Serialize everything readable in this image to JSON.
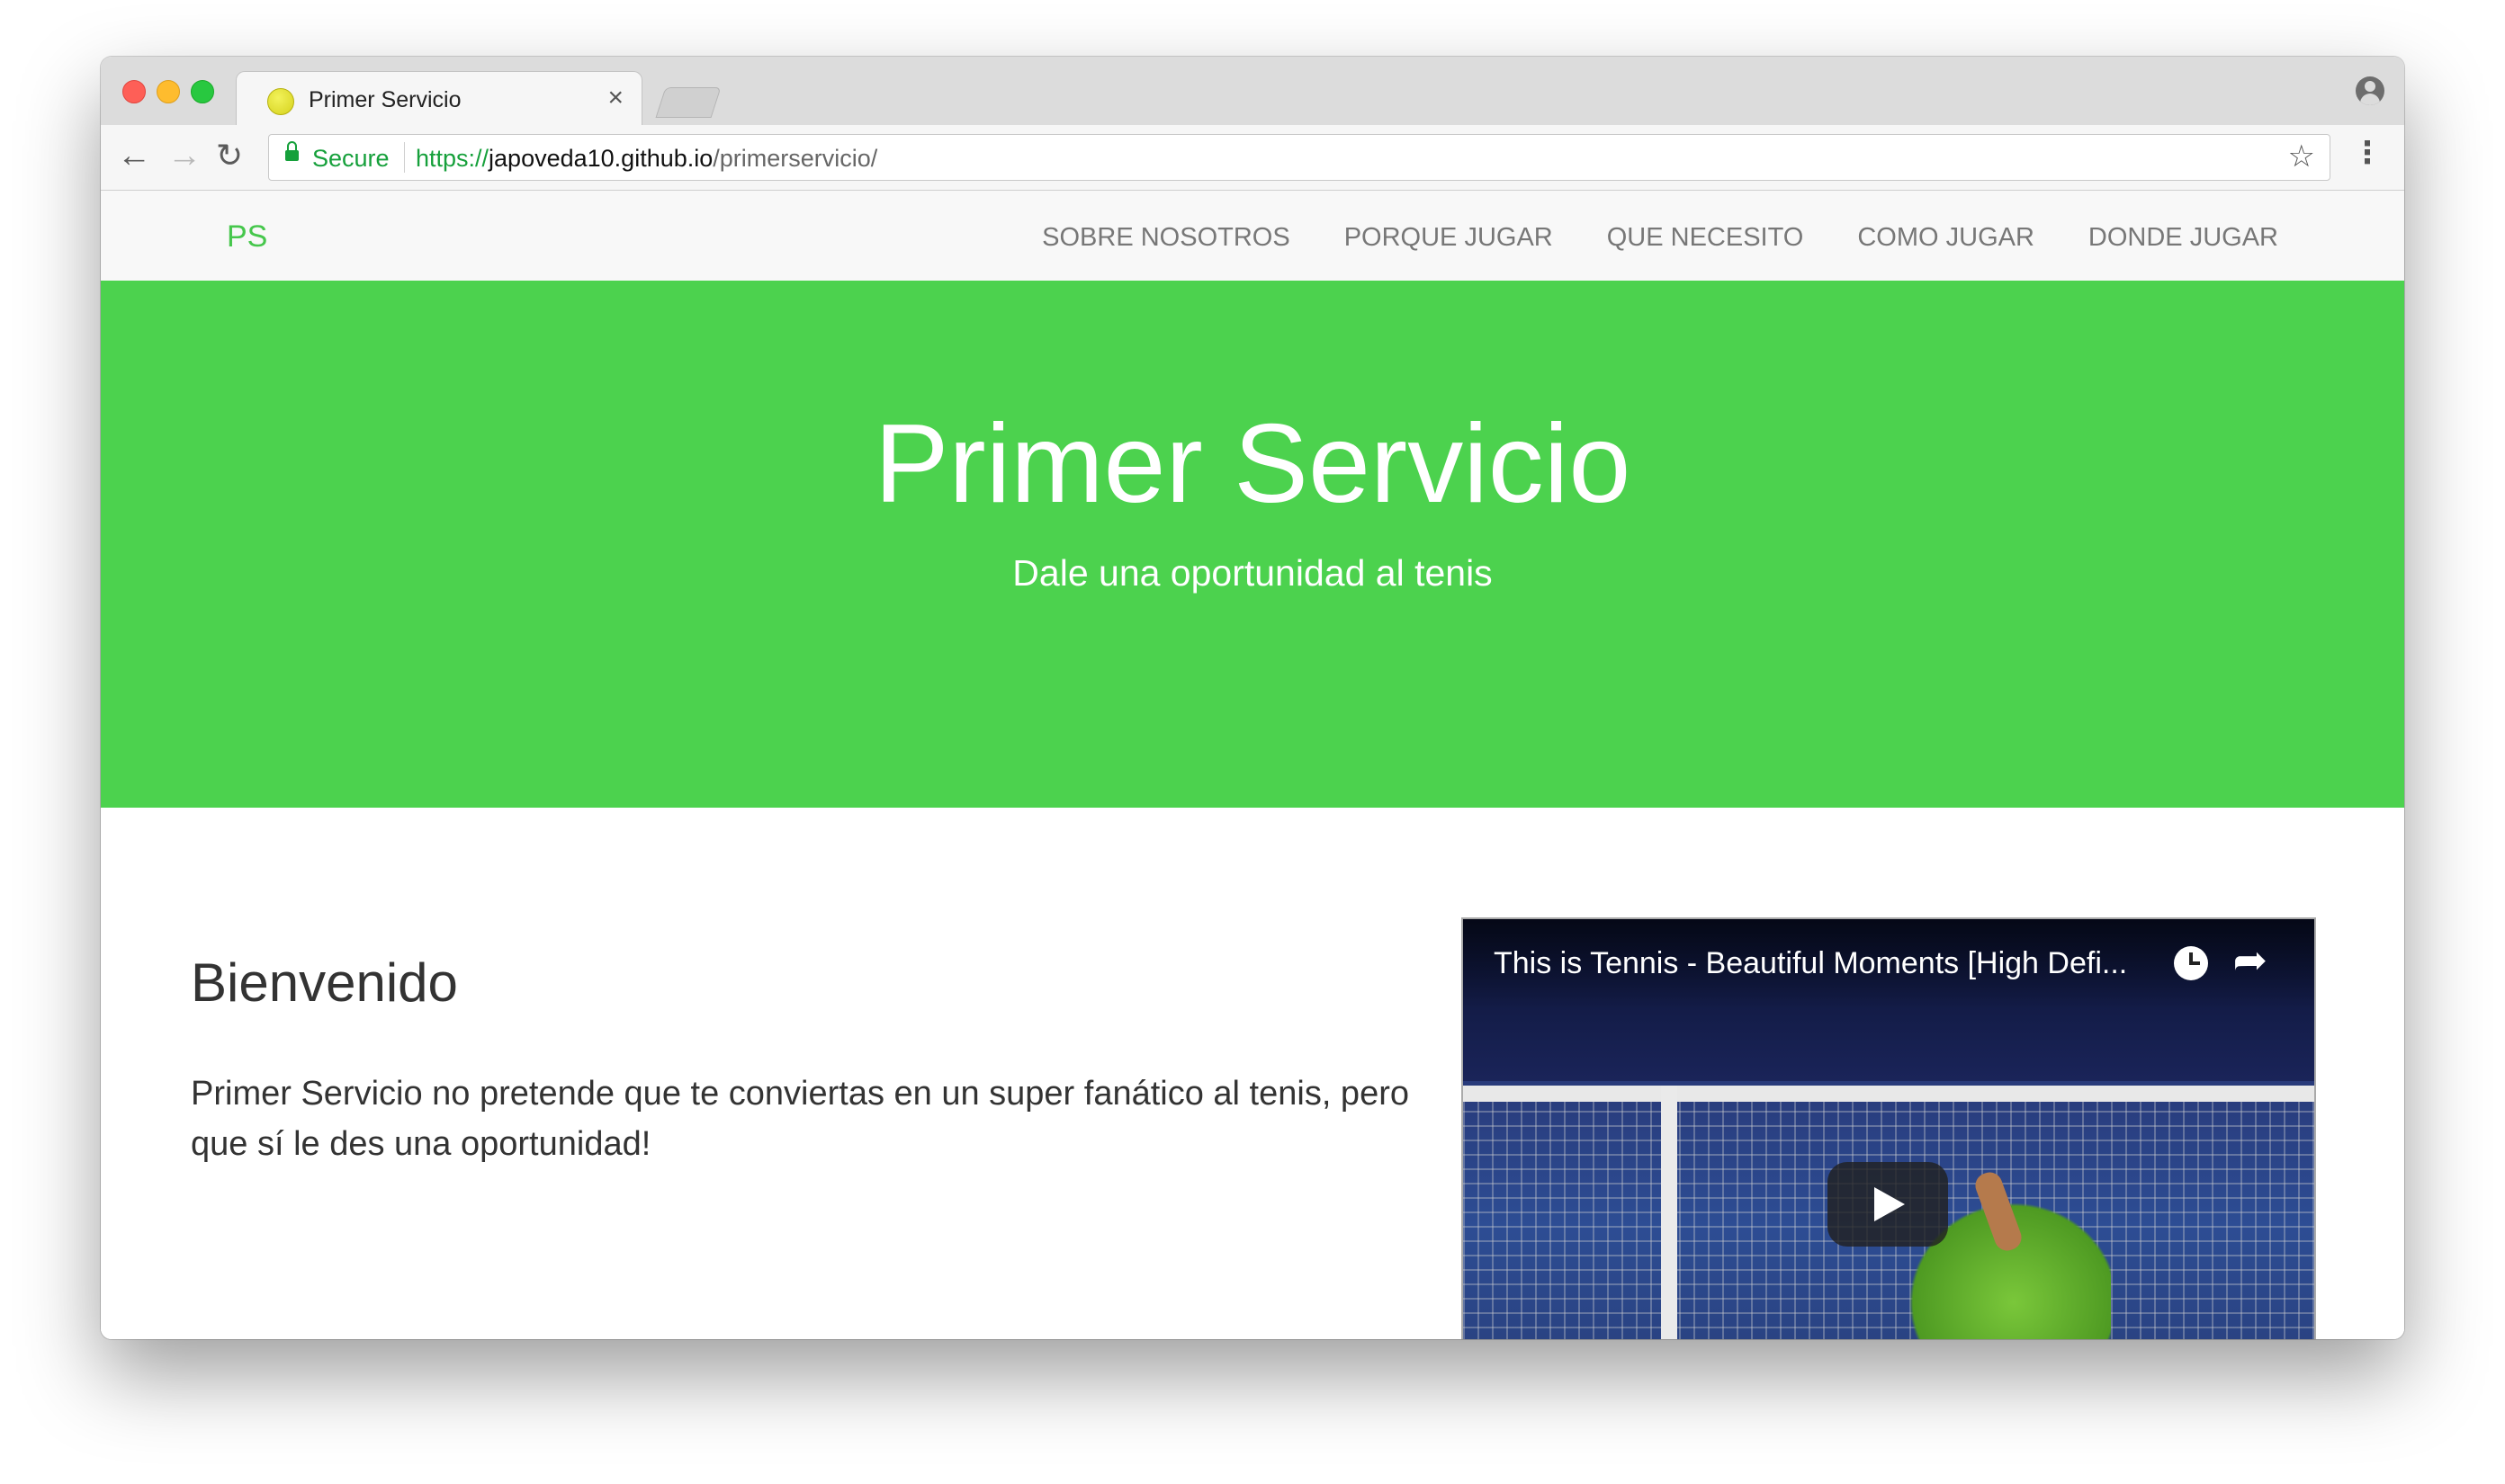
{
  "browser": {
    "tab": {
      "title": "Primer Servicio",
      "close": "×"
    },
    "address": {
      "secure_label": "Secure",
      "url_scheme": "https://",
      "url_host": "japoveda10.github.io",
      "url_path": "/primerservicio/"
    },
    "nav": {
      "back": "←",
      "forward": "→",
      "reload": "↻",
      "bookmark": "☆",
      "menu": "⋮"
    }
  },
  "site": {
    "brand": "PS",
    "nav_links": [
      "SOBRE NOSOTROS",
      "PORQUE JUGAR",
      "QUE NECESITO",
      "COMO JUGAR",
      "DONDE JUGAR"
    ],
    "hero": {
      "title": "Primer Servicio",
      "subtitle": "Dale una oportunidad al tenis"
    },
    "welcome": {
      "title": "Bienvenido",
      "text": "Primer Servicio no pretende que te conviertas en un super fanático al tenis, pero que sí le des una oportunidad!"
    },
    "video": {
      "title": "This is Tennis - Beautiful Moments [High Defi...",
      "share": "➦"
    }
  },
  "colors": {
    "brand_green": "#4cd24e",
    "secure_green": "#16a03b"
  }
}
